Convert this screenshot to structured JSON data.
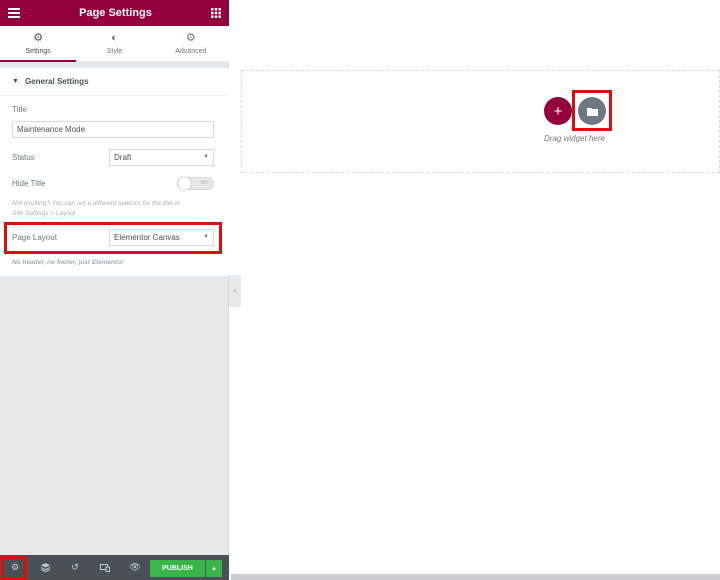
{
  "header": {
    "title": "Page Settings",
    "menu_icon": "hamburger-icon",
    "grid_icon": "grid-icon"
  },
  "tabs": [
    {
      "label": "Settings",
      "icon": "gear-icon",
      "active": true
    },
    {
      "label": "Style",
      "icon": "half-circle-icon",
      "active": false
    },
    {
      "label": "Advanced",
      "icon": "gear-icon",
      "active": false
    }
  ],
  "section": {
    "title": "General Settings",
    "title_label": "Title",
    "title_value": "Maintenance Mode",
    "status_label": "Status",
    "status_value": "Draft",
    "hide_title_label": "Hide Title",
    "hide_title_toggle": "NO",
    "hide_title_help_1": "Not working? You can set a different selector for the title in",
    "hide_title_help_2": "Site Settings > Layout",
    "page_layout_label": "Page Layout",
    "page_layout_value": "Elementor Canvas",
    "page_layout_help": "No header, no footer, just Elementor"
  },
  "footer": {
    "publish_label": "PUBLISH",
    "icons": [
      "gear-icon",
      "layers-icon",
      "history-icon",
      "responsive-icon",
      "eye-icon"
    ]
  },
  "canvas": {
    "drag_text": "Drag widget here"
  },
  "colors": {
    "brand": "#93003c",
    "publish": "#39b54a",
    "highlight": "#e10c0c"
  }
}
